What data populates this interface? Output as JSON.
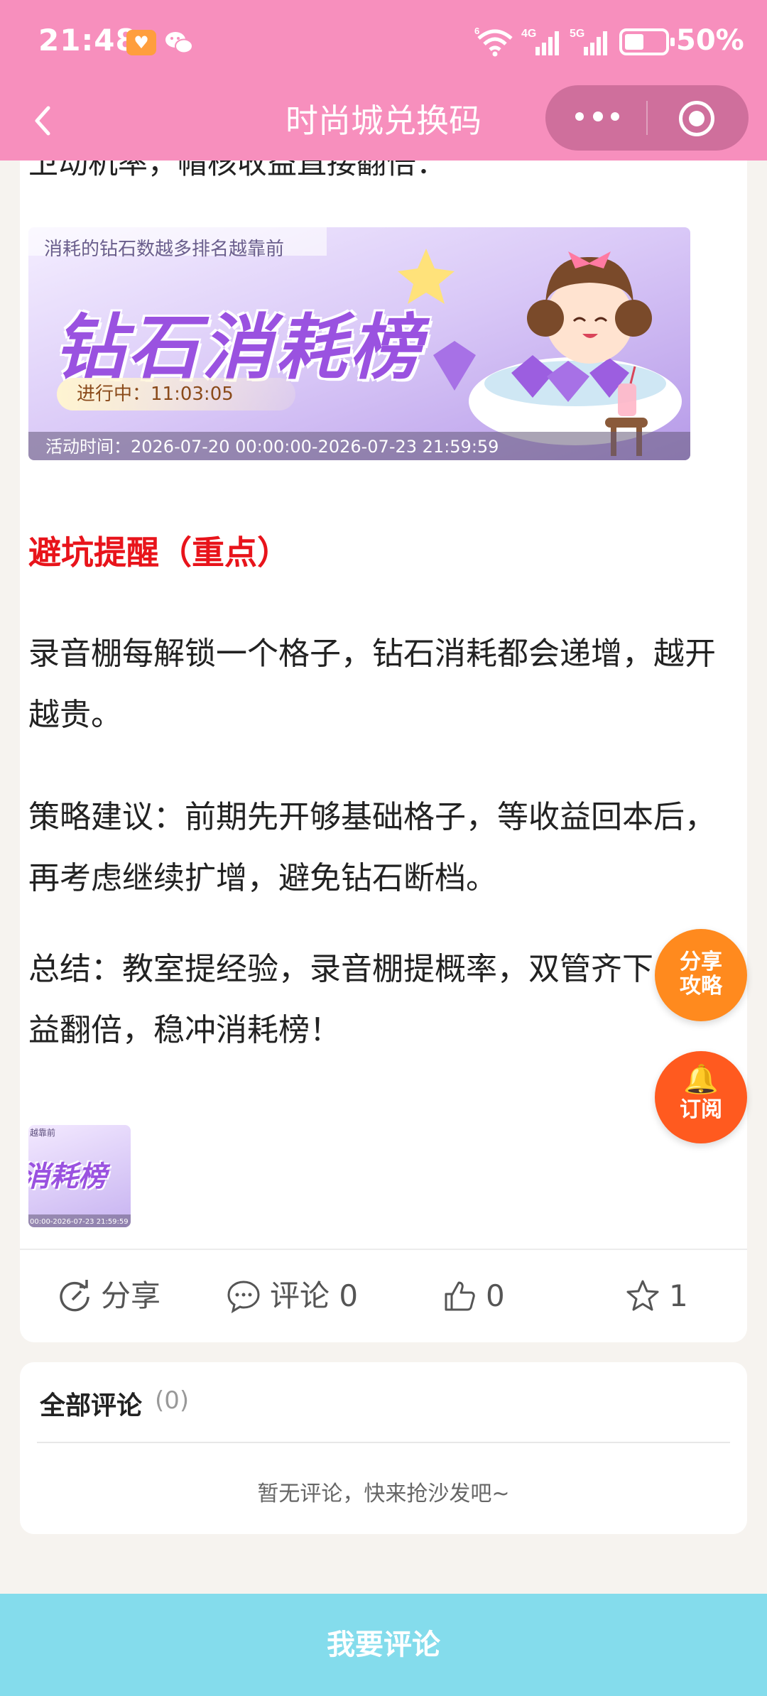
{
  "status_bar": {
    "time": "21:48",
    "network_wifi": "6",
    "network_4g": "4G",
    "network_5g": "5G",
    "battery": "50%"
  },
  "nav": {
    "title": "时尚城兑换码"
  },
  "article": {
    "cutoff_line": "卫动机率，帽核收益直接翻倍：",
    "banner": {
      "subtitle": "消耗的钻石数越多排名越靠前",
      "title": "钻石消耗榜",
      "progress": "进行中：11:03:05",
      "time": "活动时间：2026-07-20 00:00:00-2026-07-23 21:59:59"
    },
    "section_title": "避坑提醒（重点）",
    "paragraphs": [
      "录音棚每解锁一个格子，钻石消耗都会递增，越开越贵。",
      "策略建议：前期先开够基础格子，等收益回本后，再考虑继续扩增，避免钻石断档。",
      "总结：教室提经验，录音棚提概率，双管齐下，收益翻倍，稳冲消耗榜！"
    ],
    "thumb": {
      "top_text": "越靠前",
      "title": "消耗榜",
      "time": "00:00-2026-07-23 21:59:59"
    }
  },
  "actions": {
    "share": "分享",
    "comment": "评论 0",
    "like": "0",
    "favorite": "1"
  },
  "floating": {
    "share_guide": "分享攻略",
    "subscribe": "订阅"
  },
  "comments": {
    "title": "全部评论",
    "count": "(0)",
    "empty": "暂无评论，快来抢沙发吧~"
  },
  "bottom": {
    "button": "我要评论"
  },
  "colors": {
    "header": "#f78fbd",
    "capsule": "#cf6f9c",
    "warning_title": "#e8141b",
    "float_share": "#ff8a1e",
    "float_subscribe": "#ff5a1f",
    "bottom_button": "#84dcec"
  }
}
